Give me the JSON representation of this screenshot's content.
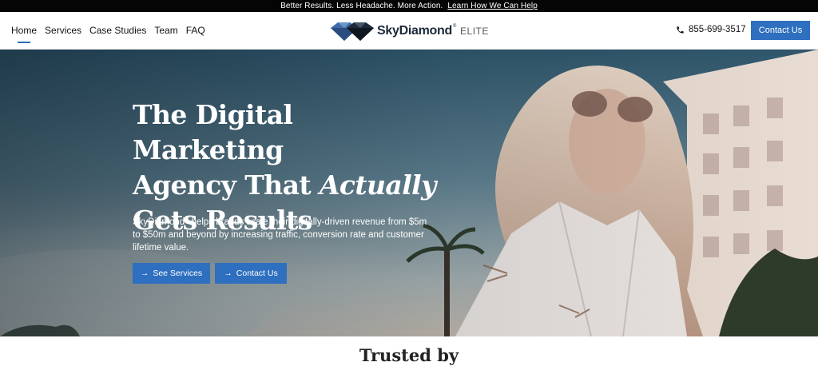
{
  "announcement": {
    "text": "Better Results. Less Headache. More Action.",
    "link": "Learn How We Can Help"
  },
  "nav": {
    "items": [
      "Home",
      "Services",
      "Case Studies",
      "Team",
      "FAQ"
    ],
    "active": "Home"
  },
  "logo": {
    "brand": "SkyDiamond",
    "reg": "®",
    "suffix": "ELITE"
  },
  "header": {
    "phone": "855-699-3517",
    "cta_label": "Contact Us"
  },
  "hero": {
    "title_line1": "The Digital Marketing",
    "title_line2_pre": "Agency That ",
    "title_line2_em": "Actually",
    "title_line3": "Gets Results",
    "sub_brand": "SkyDiamond",
    "sub_reg": "®",
    "sub_text": " helps brands scale their digitally-driven revenue from $5m to $50m and beyond by increasing traffic, conversion rate and customer lifetime value.",
    "button_services": "See Services",
    "button_contact": "Contact Us",
    "arrow": "→"
  },
  "trusted": {
    "heading": "Trusted by"
  },
  "colors": {
    "accent": "#2e6fbf",
    "topbar": "#050505",
    "text": "#111111"
  },
  "icons": {
    "phone": "phone-icon",
    "logo": "diamond-logo-icon",
    "arrow": "arrow-right-icon"
  }
}
